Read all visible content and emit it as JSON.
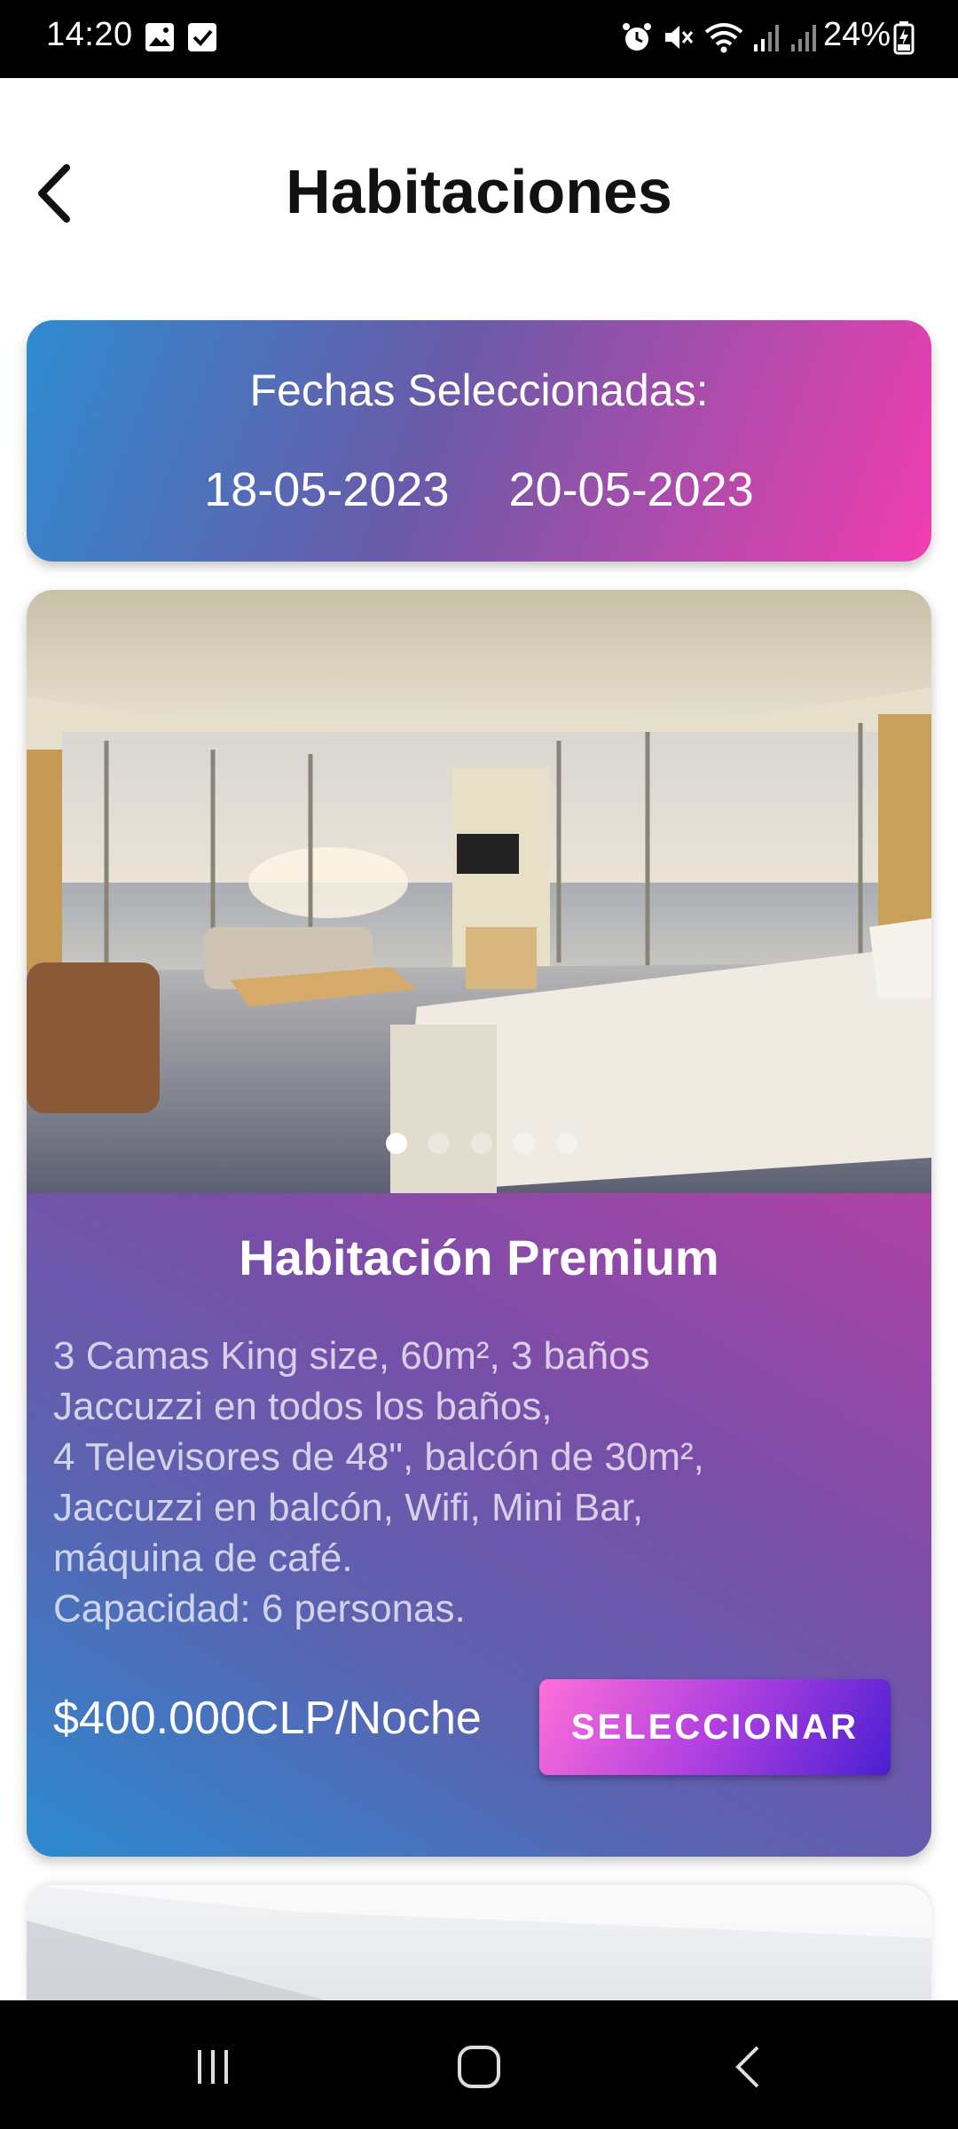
{
  "status_bar": {
    "time": "14:20",
    "battery": "24%",
    "icons": [
      "image-icon",
      "checkbox-icon",
      "alarm-icon",
      "mute-icon",
      "wifi-icon",
      "signal-icon",
      "signal-icon-2",
      "battery-icon"
    ]
  },
  "header": {
    "title": "Habitaciones",
    "back_icon": "chevron-left-icon"
  },
  "dates": {
    "label": "Fechas Seleccionadas:",
    "start": "18-05-2023",
    "end": "20-05-2023"
  },
  "room": {
    "title": "Habitación Premium",
    "description_lines": [
      "3 Camas King size, 60m², 3 baños",
      "Jaccuzzi en todos los baños,",
      "4 Televisores de 48\", balcón de 30m²,",
      "Jaccuzzi en balcón, Wifi, Mini Bar,",
      "máquina de café.",
      "Capacidad: 6 personas."
    ],
    "price": "$400.000CLP/Noche",
    "select_label": "SELECCIONAR",
    "carousel": {
      "count": 5,
      "active_index": 0
    }
  },
  "colors": {
    "gradient_blue": "#2e8bd0",
    "gradient_purple": "#6a5aa8",
    "gradient_pink": "#f23db0",
    "button_pink": "#ff6fd8",
    "button_violet": "#4a1fd2"
  },
  "nav_bar": {
    "icons": [
      "recent-apps-icon",
      "home-icon",
      "back-icon"
    ]
  }
}
